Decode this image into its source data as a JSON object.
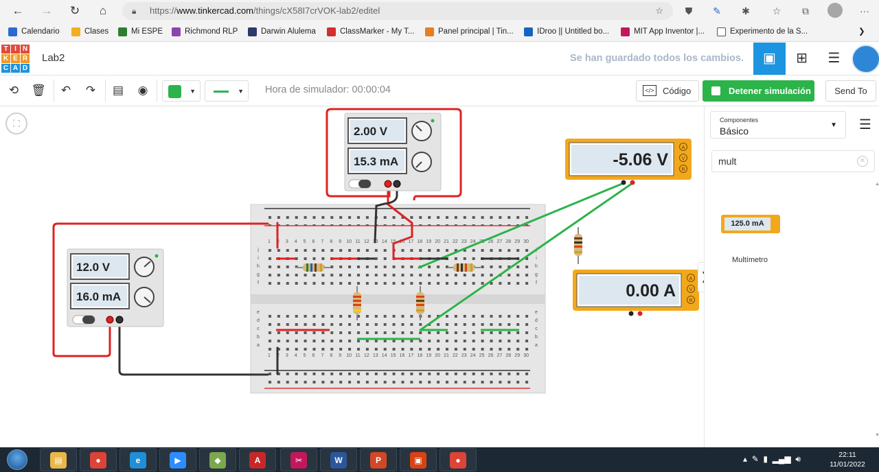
{
  "browser": {
    "url_prefix": "https://",
    "url_domain": "www.tinkercad.com",
    "url_path": "/things/cX58I7crVOK-lab2/editel",
    "bookmarks": [
      {
        "label": "Calendario",
        "color": "#2b6bd1"
      },
      {
        "label": "Clases",
        "color": "#f2b01e"
      },
      {
        "label": "Mi ESPE",
        "color": "#2e7d32"
      },
      {
        "label": "Richmond RLP",
        "color": "#8e44ad"
      },
      {
        "label": "Darwin Alulema",
        "color": "#2b3a67"
      },
      {
        "label": "ClassMarker - My T...",
        "color": "#d32f2f"
      },
      {
        "label": "Panel principal | Tin...",
        "color": "#e67e22"
      },
      {
        "label": "IDroo || Untitled bo...",
        "color": "#1565c0"
      },
      {
        "label": "MIT App Inventor |...",
        "color": "#c2185b"
      },
      {
        "label": "Experimento de la S...",
        "color": "#ffffff"
      }
    ]
  },
  "header": {
    "title": "Lab2",
    "save_status": "Se han guardado todos los cambios."
  },
  "toolbar": {
    "sim_time": "Hora de simulador: 00:00:04",
    "code_label": "Código",
    "stop_label": "Detener simulación",
    "send_label": "Send To",
    "shape_color": "#2cb34a"
  },
  "panel": {
    "components_label": "Componentes",
    "components_value": "Básico",
    "search_value": "mult",
    "multimeter_reading": "125.0 mA",
    "multimeter_label": "Multímetro"
  },
  "circuit": {
    "psu_top": {
      "voltage": "2.00 V",
      "current": "15.3 mA"
    },
    "psu_left": {
      "voltage": "12.0 V",
      "current": "16.0 mA"
    },
    "meter_volt": {
      "reading": "-5.06 V"
    },
    "meter_amp": {
      "reading": "0.00 A"
    },
    "meter_modes": [
      "A",
      "V",
      "R"
    ],
    "col_numbers": [
      "1",
      "2",
      "3",
      "4",
      "5",
      "6",
      "7",
      "8",
      "9",
      "10",
      "11",
      "12",
      "13",
      "14",
      "15",
      "16",
      "17",
      "18",
      "19",
      "20",
      "21",
      "22",
      "23",
      "24",
      "25",
      "26",
      "27",
      "28",
      "29",
      "30"
    ],
    "row_letters_top": [
      "j",
      "i",
      "h",
      "g",
      "f"
    ],
    "row_letters_bottom": [
      "e",
      "d",
      "c",
      "b",
      "a"
    ]
  },
  "taskbar": {
    "apps": [
      {
        "name": "explorer",
        "glyph": "▤",
        "color": "#e8b84a"
      },
      {
        "name": "chrome",
        "glyph": "●",
        "color": "#db4437"
      },
      {
        "name": "edge",
        "glyph": "e",
        "color": "#1f8fd6"
      },
      {
        "name": "zoom",
        "glyph": "▶",
        "color": "#2d8cff"
      },
      {
        "name": "sketchup",
        "glyph": "◆",
        "color": "#7aa84c"
      },
      {
        "name": "acrobat",
        "glyph": "A",
        "color": "#c62828"
      },
      {
        "name": "snipping",
        "glyph": "✂",
        "color": "#c2185b"
      },
      {
        "name": "word",
        "glyph": "W",
        "color": "#2b579a"
      },
      {
        "name": "powerpoint",
        "glyph": "P",
        "color": "#d24726"
      },
      {
        "name": "pdf",
        "glyph": "▣",
        "color": "#d84315"
      },
      {
        "name": "chrome-profile",
        "glyph": "●",
        "color": "#db4437"
      }
    ],
    "time": "22:11",
    "date": "11/01/2022"
  }
}
